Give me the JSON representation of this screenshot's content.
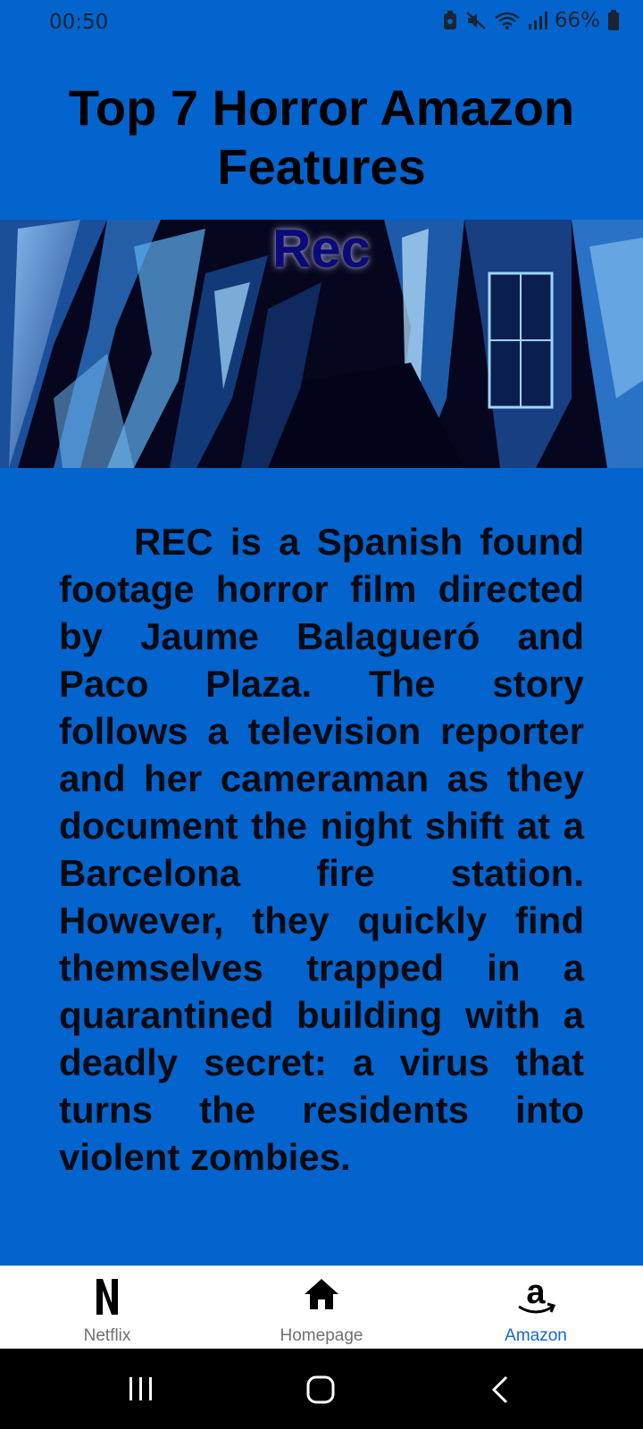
{
  "status_bar": {
    "time": "00:50",
    "battery": "66%"
  },
  "page": {
    "title": "Top 7 Horror Amazon Features"
  },
  "feature": {
    "title": "Rec",
    "description": "REC is a Spanish found footage horror film directed by Jaume Balagueró and Paco Plaza. The story follows a television reporter and her cameraman as they document the night shift at a Barcelona fire station. However, they quickly find themselves trapped in a quarantined building with a deadly secret: a virus that turns the residents into violent zombies."
  },
  "bottom_nav": {
    "items": [
      {
        "label": "Netflix",
        "icon": "netflix-icon",
        "active": false
      },
      {
        "label": "Homepage",
        "icon": "home-icon",
        "active": false
      },
      {
        "label": "Amazon",
        "icon": "amazon-icon",
        "active": true
      }
    ]
  },
  "colors": {
    "background": "#0264cc",
    "active_nav": "#1565d8",
    "hero_title": "#0b0a7a"
  }
}
